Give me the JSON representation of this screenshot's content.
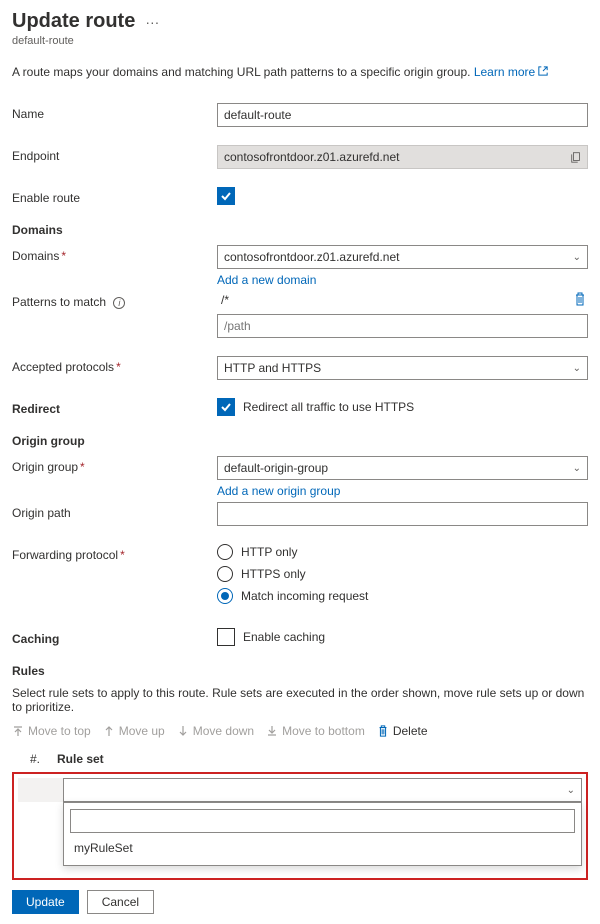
{
  "header": {
    "title": "Update route",
    "subtitle": "default-route"
  },
  "description": "A route maps your domains and matching URL path patterns to a specific origin group.",
  "learnMore": "Learn more",
  "fields": {
    "name": {
      "label": "Name",
      "value": "default-route"
    },
    "endpoint": {
      "label": "Endpoint",
      "value": "contosofrontdoor.z01.azurefd.net"
    },
    "enableRoute": {
      "label": "Enable route",
      "checked": true
    }
  },
  "domains": {
    "section": "Domains",
    "label": "Domains",
    "selected": "contosofrontdoor.z01.azurefd.net",
    "addLink": "Add a new domain"
  },
  "patterns": {
    "label": "Patterns to match",
    "existing": "/*",
    "placeholder": "/path"
  },
  "protocols": {
    "label": "Accepted protocols",
    "value": "HTTP and HTTPS"
  },
  "redirect": {
    "label": "Redirect",
    "text": "Redirect all traffic to use HTTPS",
    "checked": true
  },
  "originGroup": {
    "section": "Origin group",
    "label": "Origin group",
    "value": "default-origin-group",
    "addLink": "Add a new origin group"
  },
  "originPath": {
    "label": "Origin path",
    "value": ""
  },
  "forwarding": {
    "label": "Forwarding protocol",
    "options": [
      "HTTP only",
      "HTTPS only",
      "Match incoming request"
    ],
    "selectedIndex": 2
  },
  "caching": {
    "label": "Caching",
    "text": "Enable caching",
    "checked": false
  },
  "rules": {
    "section": "Rules",
    "desc": "Select rule sets to apply to this route. Rule sets are executed in the order shown, move rule sets up or down to prioritize.",
    "toolbar": {
      "moveTop": "Move to top",
      "moveUp": "Move up",
      "moveDown": "Move down",
      "moveBottom": "Move to bottom",
      "delete": "Delete"
    },
    "colNum": "#.",
    "colRuleset": "Rule set",
    "dropdownItem": "myRuleSet"
  },
  "buttons": {
    "update": "Update",
    "cancel": "Cancel"
  }
}
